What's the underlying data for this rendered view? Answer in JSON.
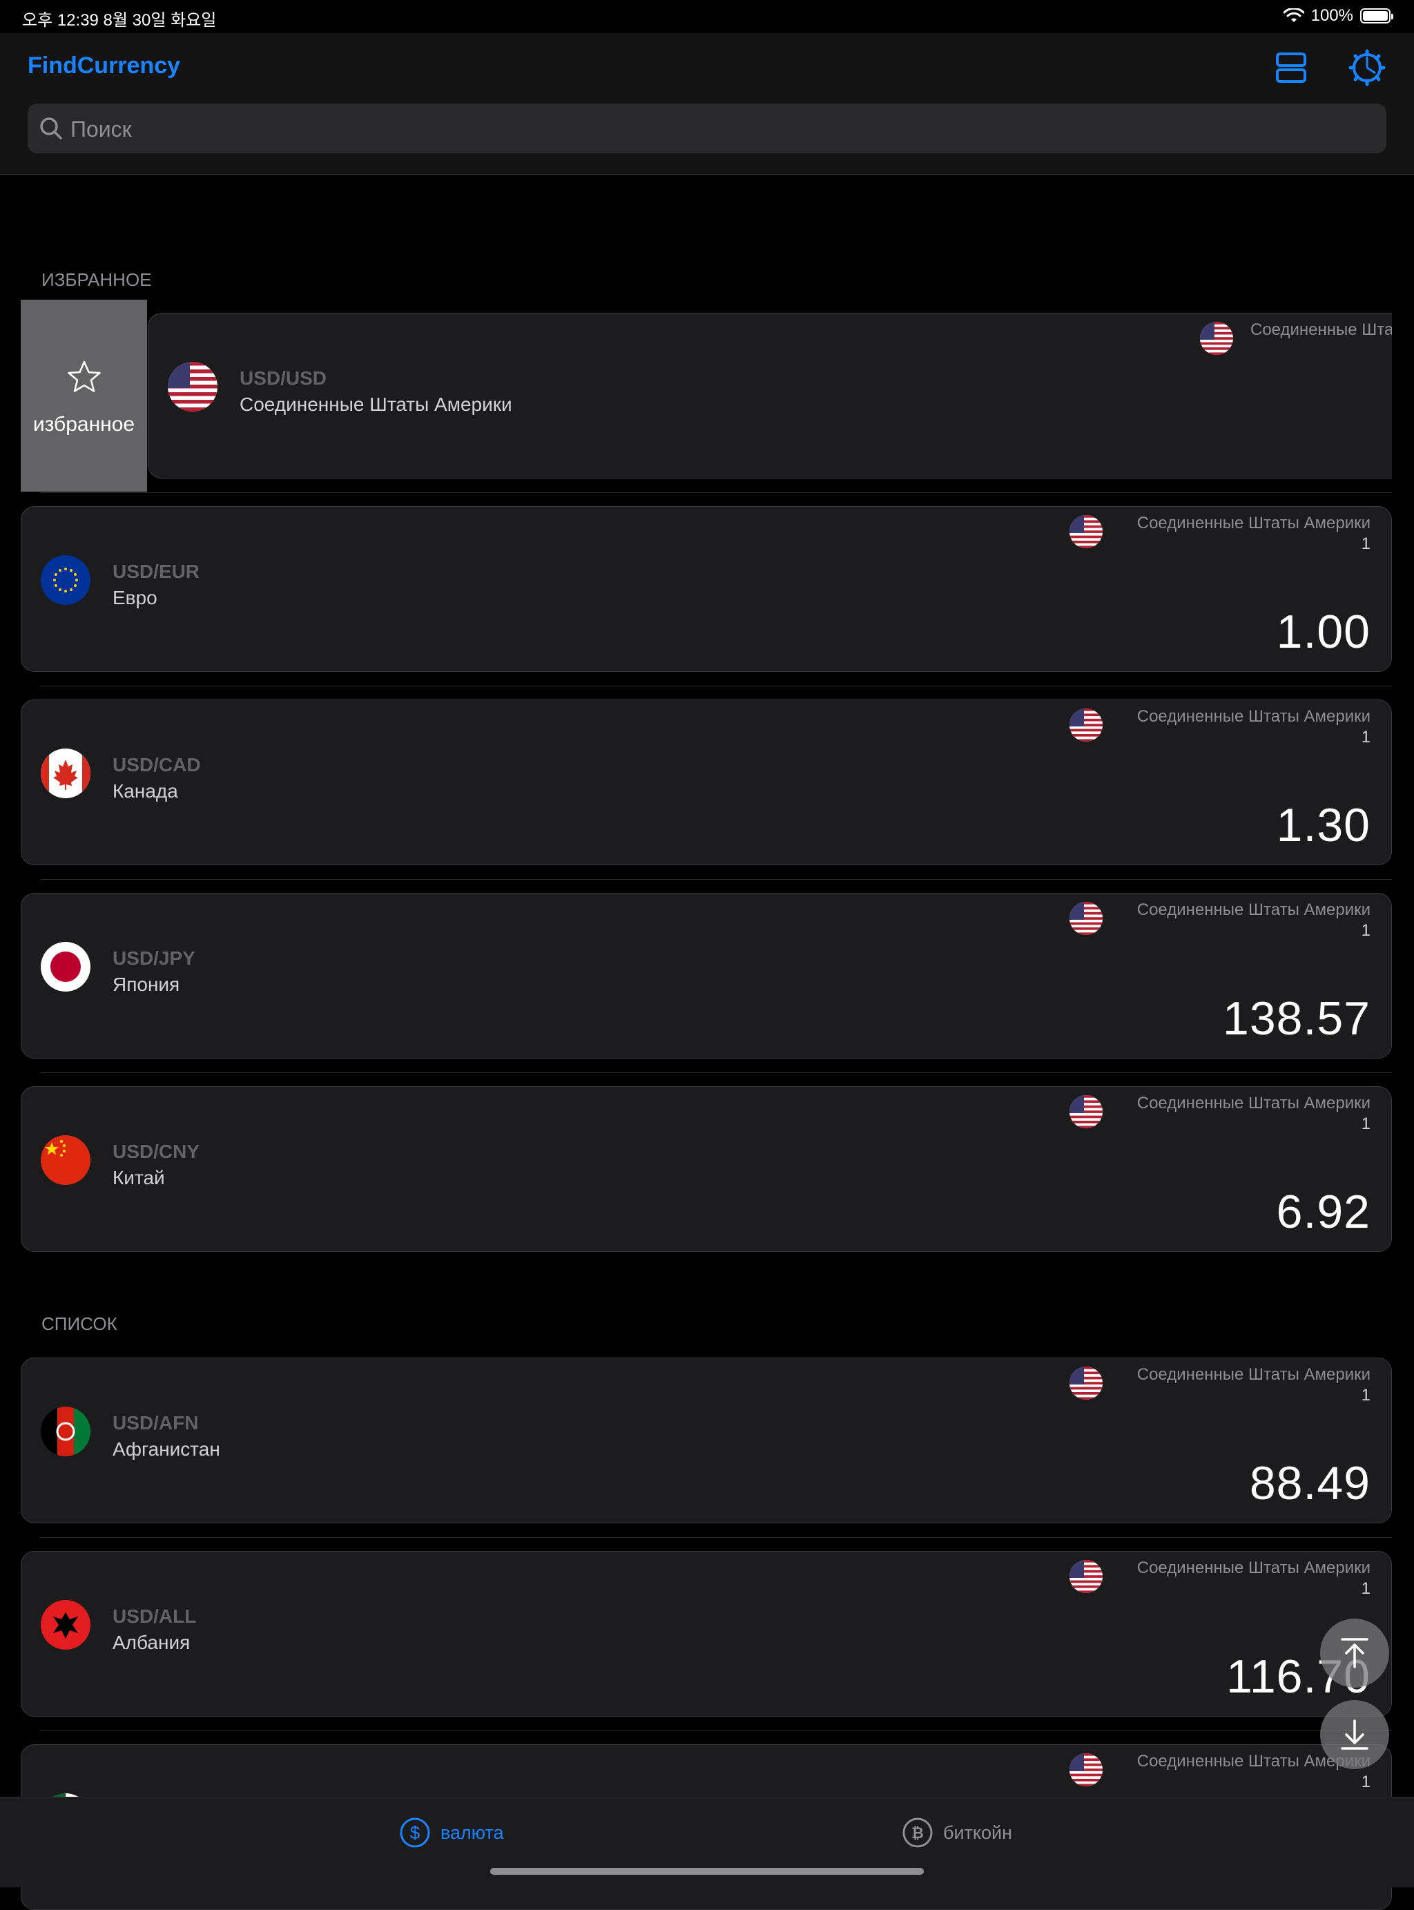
{
  "status_bar": {
    "time_date": "오후 12:39   8월 30일 화요일",
    "battery": "100%"
  },
  "header": {
    "title": "FindCurrency",
    "search_placeholder": "Поиск"
  },
  "sections": {
    "favorites": "ИЗБРАННОЕ",
    "list": "СПИСОК"
  },
  "swipe_action": {
    "label": "избранное"
  },
  "base": {
    "name": "Соединенные Штаты Америки",
    "amount": "1"
  },
  "favorites": [
    {
      "pair": "USD/USD",
      "country": "Соединенные Штаты Америки",
      "flag": "us-flag",
      "rate": ""
    },
    {
      "pair": "USD/EUR",
      "country": "Евро",
      "flag": "eu-flag",
      "rate": "1.00"
    },
    {
      "pair": "USD/CAD",
      "country": "Канада",
      "flag": "ca-flag",
      "rate": "1.30"
    },
    {
      "pair": "USD/JPY",
      "country": "Япония",
      "flag": "jp-flag",
      "rate": "138.57"
    },
    {
      "pair": "USD/CNY",
      "country": "Китай",
      "flag": "cn-flag",
      "rate": "6.92"
    }
  ],
  "list": [
    {
      "pair": "USD/AFN",
      "country": "Афганистан",
      "flag": "af-flag",
      "rate": "88.49"
    },
    {
      "pair": "USD/ALL",
      "country": "Албания",
      "flag": "al-flag",
      "rate": "116.70"
    },
    {
      "pair": "",
      "country": "",
      "flag": "dz-flag",
      "rate": ""
    }
  ],
  "tabs": [
    {
      "label": "валюта",
      "icon": "dollar-circle-icon",
      "active": true
    },
    {
      "label": "биткойн",
      "icon": "bitcoin-circle-icon",
      "active": false
    }
  ],
  "colors": {
    "accent": "#1a84ff",
    "background": "#000000",
    "card": "#1c1c1e",
    "swipe_action": "#636366"
  }
}
